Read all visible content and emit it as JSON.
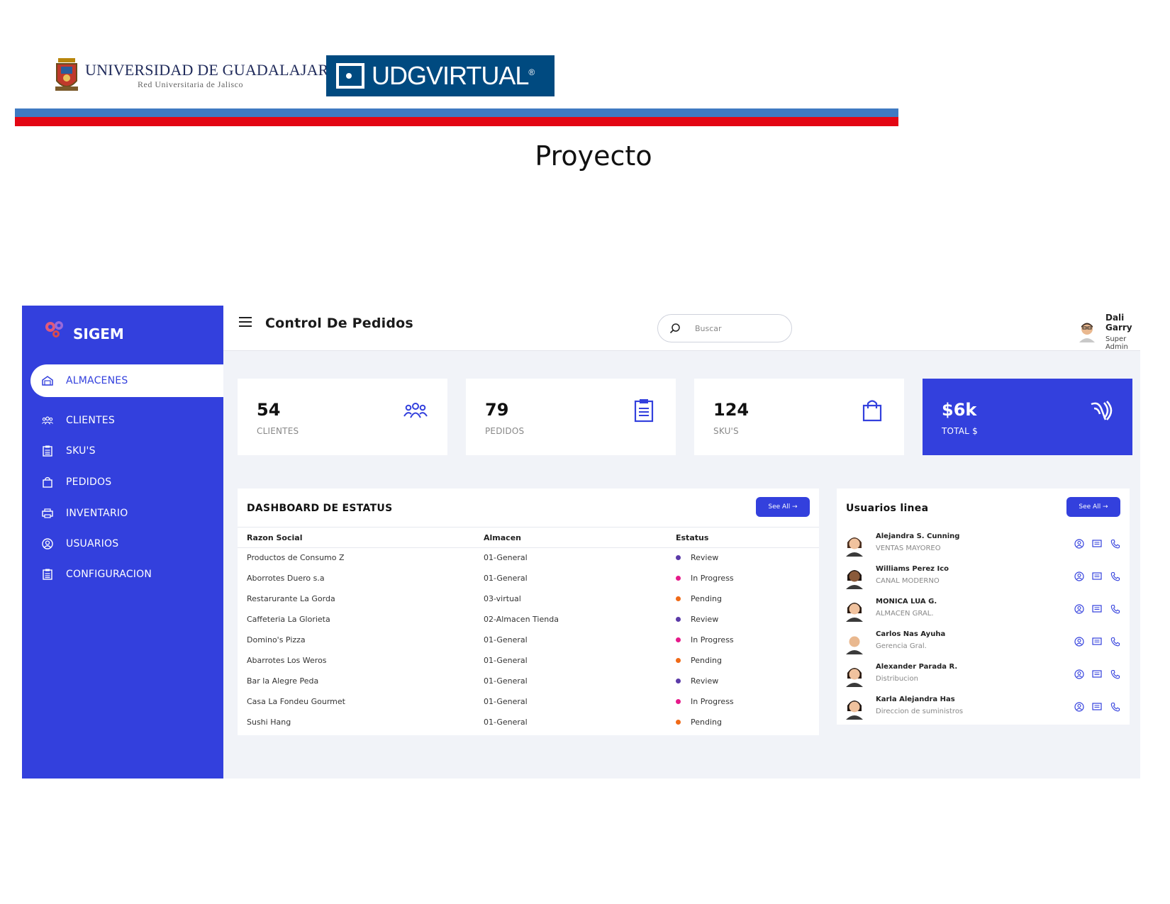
{
  "header": {
    "udg_name": "UNIVERSIDAD DE GUADALAJARA",
    "udg_sub": "Red Universitaria de Jalisco",
    "udgv_name": "UDGVIRTUAL",
    "udgv_mark": "®",
    "doc_title": "Proyecto"
  },
  "colors": {
    "primary": "#3340dd",
    "bg": "#f1f3f8",
    "review": "#5b3aa8",
    "in_progress": "#e6198a",
    "pending": "#f06a17"
  },
  "app": {
    "brand": "SIGEM",
    "page_title": "Control De Pedidos",
    "search": {
      "placeholder": "Buscar"
    },
    "user": {
      "name": "Dali Garry",
      "role": "Super Admin"
    },
    "sidebar": {
      "items": [
        {
          "label": "ALMACENES",
          "icon": "warehouse-icon"
        },
        {
          "label": "CLIENTES",
          "icon": "users-icon"
        },
        {
          "label": "SKU'S",
          "icon": "clipboard-icon"
        },
        {
          "label": "PEDIDOS",
          "icon": "bag-icon"
        },
        {
          "label": "INVENTARIO",
          "icon": "printer-icon"
        },
        {
          "label": "USUARIOS",
          "icon": "user-circle-icon"
        },
        {
          "label": "CONFIGURACION",
          "icon": "clipboard-icon"
        }
      ]
    },
    "cards": [
      {
        "value": "54",
        "label": "CLIENTES",
        "icon": "users-icon"
      },
      {
        "value": "79",
        "label": "PEDIDOS",
        "icon": "clipboard-icon"
      },
      {
        "value": "124",
        "label": "SKU'S",
        "icon": "bag-icon"
      },
      {
        "value": "$6k",
        "label": "TOTAL $",
        "icon": "money-icon"
      }
    ],
    "status_panel": {
      "title": "DASHBOARD DE ESTATUS",
      "see_all": "See All →",
      "columns": [
        "Razon Social",
        "Almacen",
        "Estatus"
      ],
      "rows": [
        {
          "razon": "Productos de Consumo Z",
          "almacen": "01-General",
          "estatus": "Review",
          "kind": "review"
        },
        {
          "razon": "Aborrotes Duero s.a",
          "almacen": "01-General",
          "estatus": "In Progress",
          "kind": "in_progress"
        },
        {
          "razon": "Restarurante La Gorda",
          "almacen": "03-virtual",
          "estatus": "Pending",
          "kind": "pending"
        },
        {
          "razon": "Caffeteria La Glorieta",
          "almacen": "02-Almacen Tienda",
          "estatus": "Review",
          "kind": "review"
        },
        {
          "razon": "Domino's Pizza",
          "almacen": "01-General",
          "estatus": "In Progress",
          "kind": "in_progress"
        },
        {
          "razon": "Abarrotes Los Weros",
          "almacen": "01-General",
          "estatus": "Pending",
          "kind": "pending"
        },
        {
          "razon": "Bar la Alegre Peda",
          "almacen": "01-General",
          "estatus": "Review",
          "kind": "review"
        },
        {
          "razon": "Casa La Fondeu Gourmet",
          "almacen": "01-General",
          "estatus": "In Progress",
          "kind": "in_progress"
        },
        {
          "razon": "Sushi Hang",
          "almacen": "01-General",
          "estatus": "Pending",
          "kind": "pending"
        }
      ]
    },
    "users_panel": {
      "title": "Usuarios linea",
      "see_all": "See All →",
      "users": [
        {
          "name": "Alejandra S. Cunning",
          "role": "VENTAS MAYOREO"
        },
        {
          "name": "Williams Perez Ico",
          "role": "CANAL MODERNO"
        },
        {
          "name": "MONICA LUA G.",
          "role": "ALMACEN GRAL."
        },
        {
          "name": "Carlos Nas Ayuha",
          "role": "Gerencia Gral."
        },
        {
          "name": "Alexander Parada R.",
          "role": "Distribucion"
        },
        {
          "name": "Karla Alejandra Has",
          "role": "Direccion de suministros"
        }
      ]
    }
  }
}
